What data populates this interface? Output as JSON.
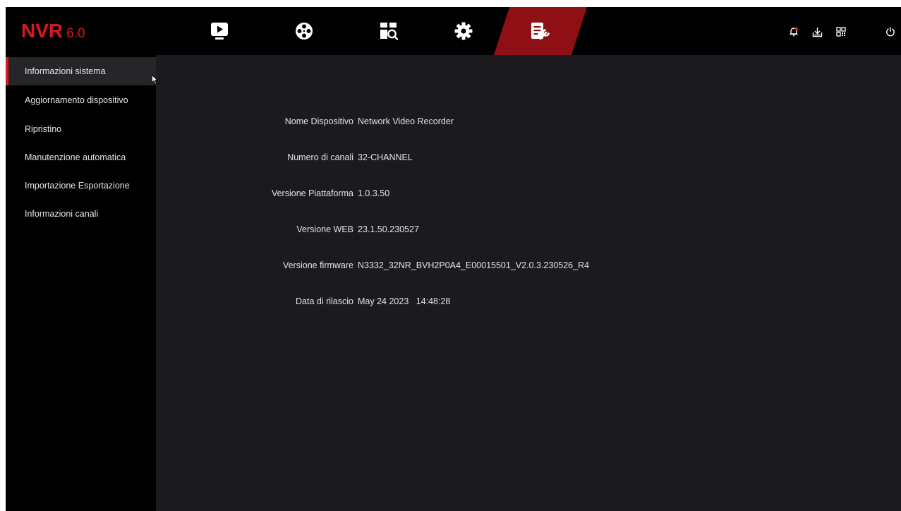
{
  "app": {
    "brand": "NVR",
    "version": "6.0"
  },
  "nav": [
    {
      "id": "live",
      "icon": "live-view-icon"
    },
    {
      "id": "playback",
      "icon": "playback-reel-icon"
    },
    {
      "id": "search",
      "icon": "smart-search-icon"
    },
    {
      "id": "settings",
      "icon": "gear-icon"
    },
    {
      "id": "maintenance",
      "icon": "maintenance-icon",
      "active": true
    }
  ],
  "toolbar": [
    {
      "icon": "alarm-bell-icon"
    },
    {
      "icon": "download-icon"
    },
    {
      "icon": "qr-code-icon"
    },
    {
      "icon": "power-icon"
    }
  ],
  "sidebar": {
    "items": [
      {
        "label": "Informazioni sistema",
        "active": true
      },
      {
        "label": "Aggiornamento dispositivo"
      },
      {
        "label": "Ripristino"
      },
      {
        "label": "Manutenzione automatica"
      },
      {
        "label": "Importazione Esportazione"
      },
      {
        "label": "Informazioni canali"
      }
    ]
  },
  "info": [
    {
      "label": "Nome Dispositivo",
      "value": "Network Video Recorder"
    },
    {
      "label": "Numero di canali",
      "value": "32-CHANNEL"
    },
    {
      "label": "Versione Piattaforma",
      "value": "1.0.3.50"
    },
    {
      "label": "Versione WEB",
      "value": "23.1.50.230527"
    },
    {
      "label": "Versione firmware",
      "value": "N3332_32NR_BVH2P0A4_E00015501_V2.0.3.230526_R4"
    },
    {
      "label": "Data di rilascio",
      "value": "May 24 2023   14:48:28"
    }
  ],
  "colors": {
    "accent": "#d9181f",
    "active_tab": "#8e1014",
    "background": "#1b1b1f",
    "sidebar": "#000000"
  }
}
